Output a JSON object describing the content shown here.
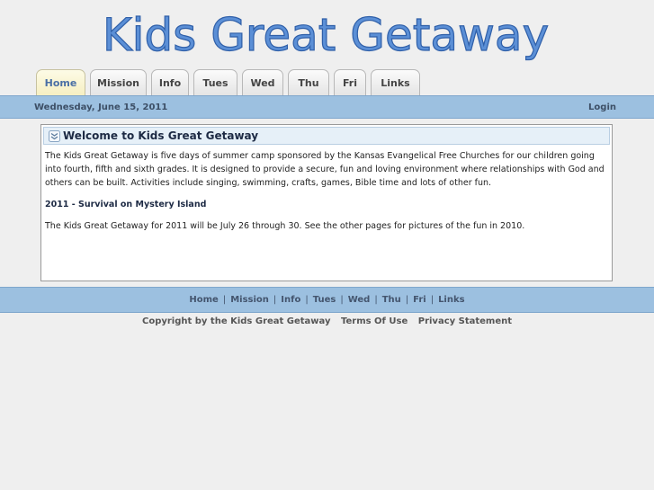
{
  "site": {
    "title": "Kids Great Getaway"
  },
  "tabs": [
    {
      "label": "Home",
      "active": true
    },
    {
      "label": "Mission",
      "active": false
    },
    {
      "label": "Info",
      "active": false
    },
    {
      "label": "Tues",
      "active": false
    },
    {
      "label": "Wed",
      "active": false
    },
    {
      "label": "Thu",
      "active": false
    },
    {
      "label": "Fri",
      "active": false
    },
    {
      "label": "Links",
      "active": false
    }
  ],
  "datebar": {
    "date": "Wednesday, June 15, 2011",
    "login": "Login"
  },
  "panel": {
    "title": "Welcome to Kids Great Getaway",
    "icon": "chevron-down-icon",
    "paragraph1": "The Kids Great Getaway is five days of summer camp sponsored by the Kansas Evangelical Free Churches for our children going into fourth, fifth and sixth grades.  It is designed to provide a secure, fun and loving environment where relationships with God and others can be built.  Activities include singing, swimming, crafts, games, Bible time and lots of other fun.",
    "heading": "2011 - Survival on Mystery Island",
    "paragraph2": "The Kids Great Getaway for 2011 will be July 26 through 30.  See the other pages for pictures of the fun in 2010."
  },
  "footer_links": [
    "Home",
    "Mission",
    "Info",
    "Tues",
    "Wed",
    "Thu",
    "Fri",
    "Links"
  ],
  "copyright": {
    "text": "Copyright by the Kids Great Getaway",
    "terms": "Terms Of Use",
    "privacy": "Privacy Statement"
  },
  "colors": {
    "logo_fill": "#5b8fd6",
    "bar": "#9cc0e0",
    "active_tab": "#f6efc2"
  }
}
